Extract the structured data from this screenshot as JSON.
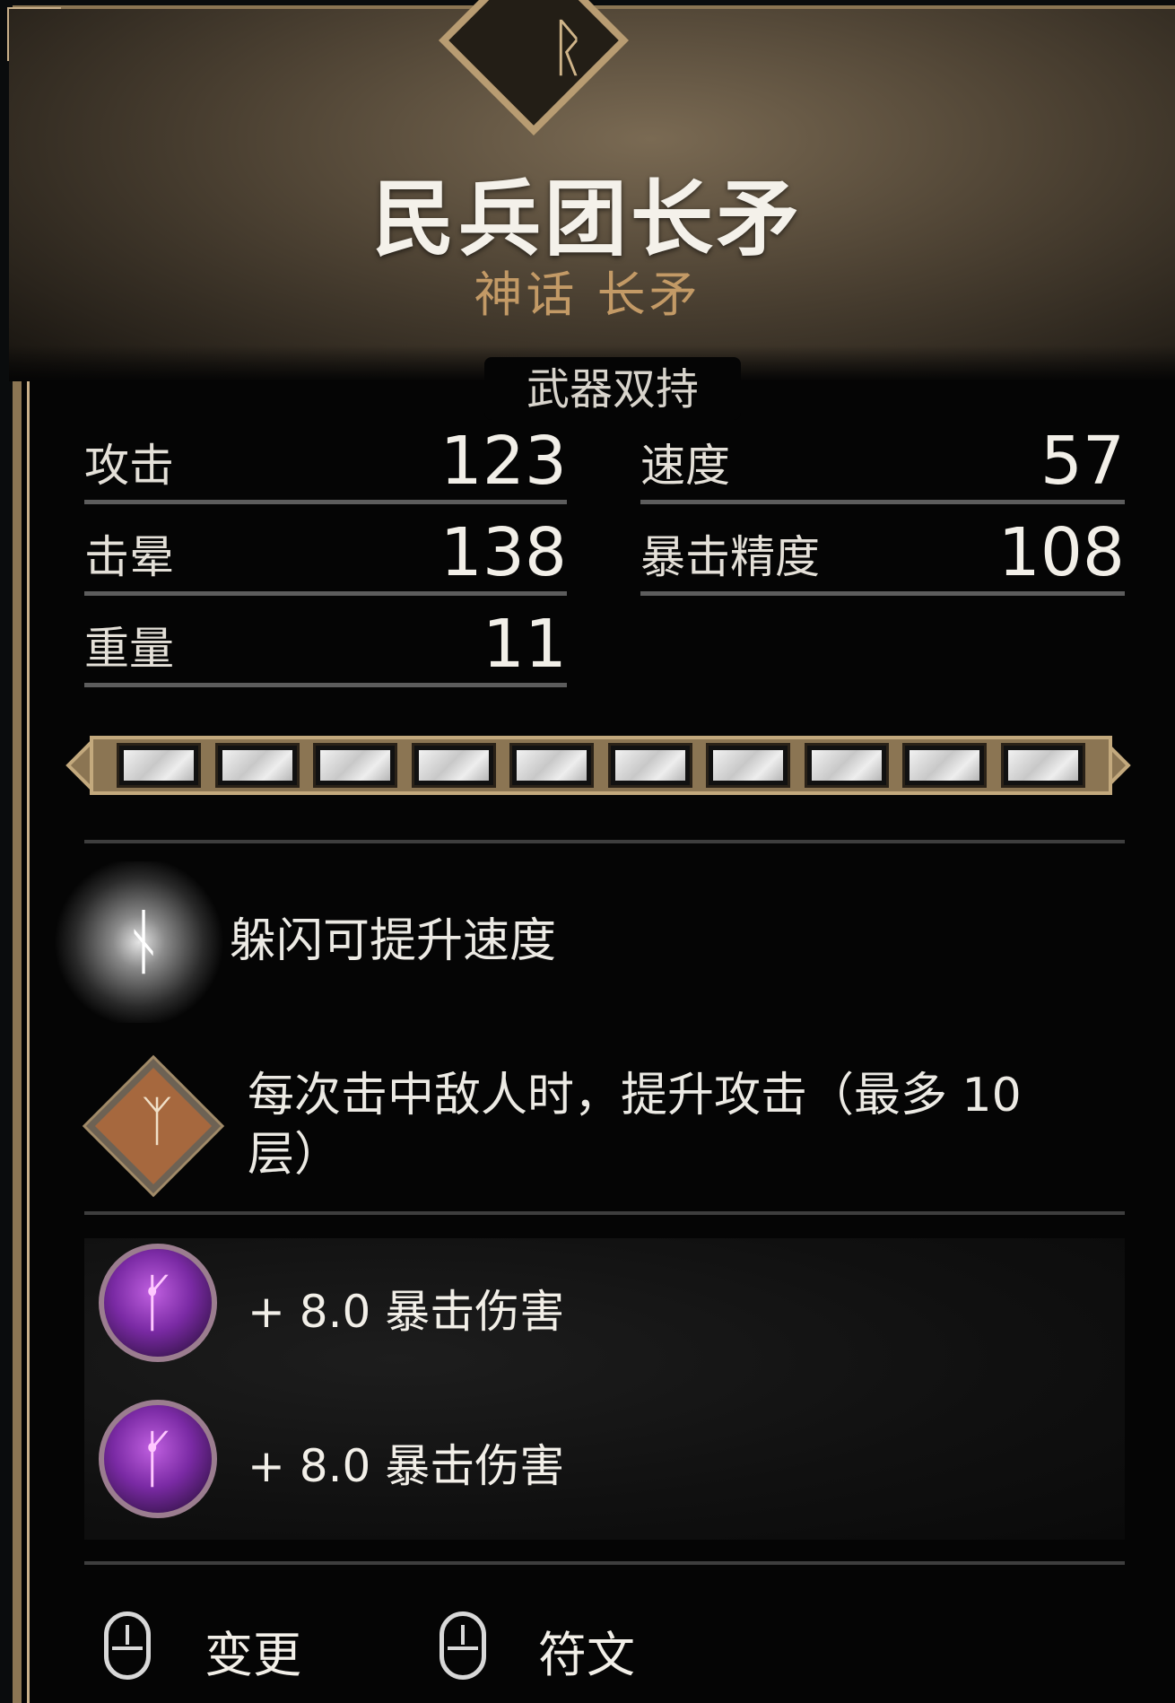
{
  "item": {
    "name": "民兵团长矛",
    "rarity_type": "神话 长矛",
    "wield_label": "武器双持"
  },
  "stats": {
    "attack": {
      "label": "攻击",
      "value": "123"
    },
    "speed": {
      "label": "速度",
      "value": "57"
    },
    "stun": {
      "label": "击晕",
      "value": "138"
    },
    "crit_chance": {
      "label": "暴击精度",
      "value": "108"
    },
    "weight": {
      "label": "重量",
      "value": "11"
    }
  },
  "upgrade_bar": {
    "filled": 10,
    "total": 10
  },
  "perks": [
    {
      "icon": "dodge-rune-icon",
      "text": "躲闪可提升速度"
    },
    {
      "icon": "attack-stack-icon",
      "text_line1": "每次击中敌人时，提升攻击（最多 10",
      "text_line2": "层）"
    }
  ],
  "runes": [
    {
      "icon": "purple-rune-icon",
      "text": "+ 8.0 暴击伤害"
    },
    {
      "icon": "purple-rune-icon",
      "text": "+ 8.0 暴击伤害"
    }
  ],
  "actions": {
    "change_label": "变更",
    "rune_label": "符文"
  },
  "colors": {
    "title": "#f4f1ea",
    "rarity": "#c39a66",
    "frame": "#8b7553",
    "rune_purple": "#7a2aa4"
  }
}
